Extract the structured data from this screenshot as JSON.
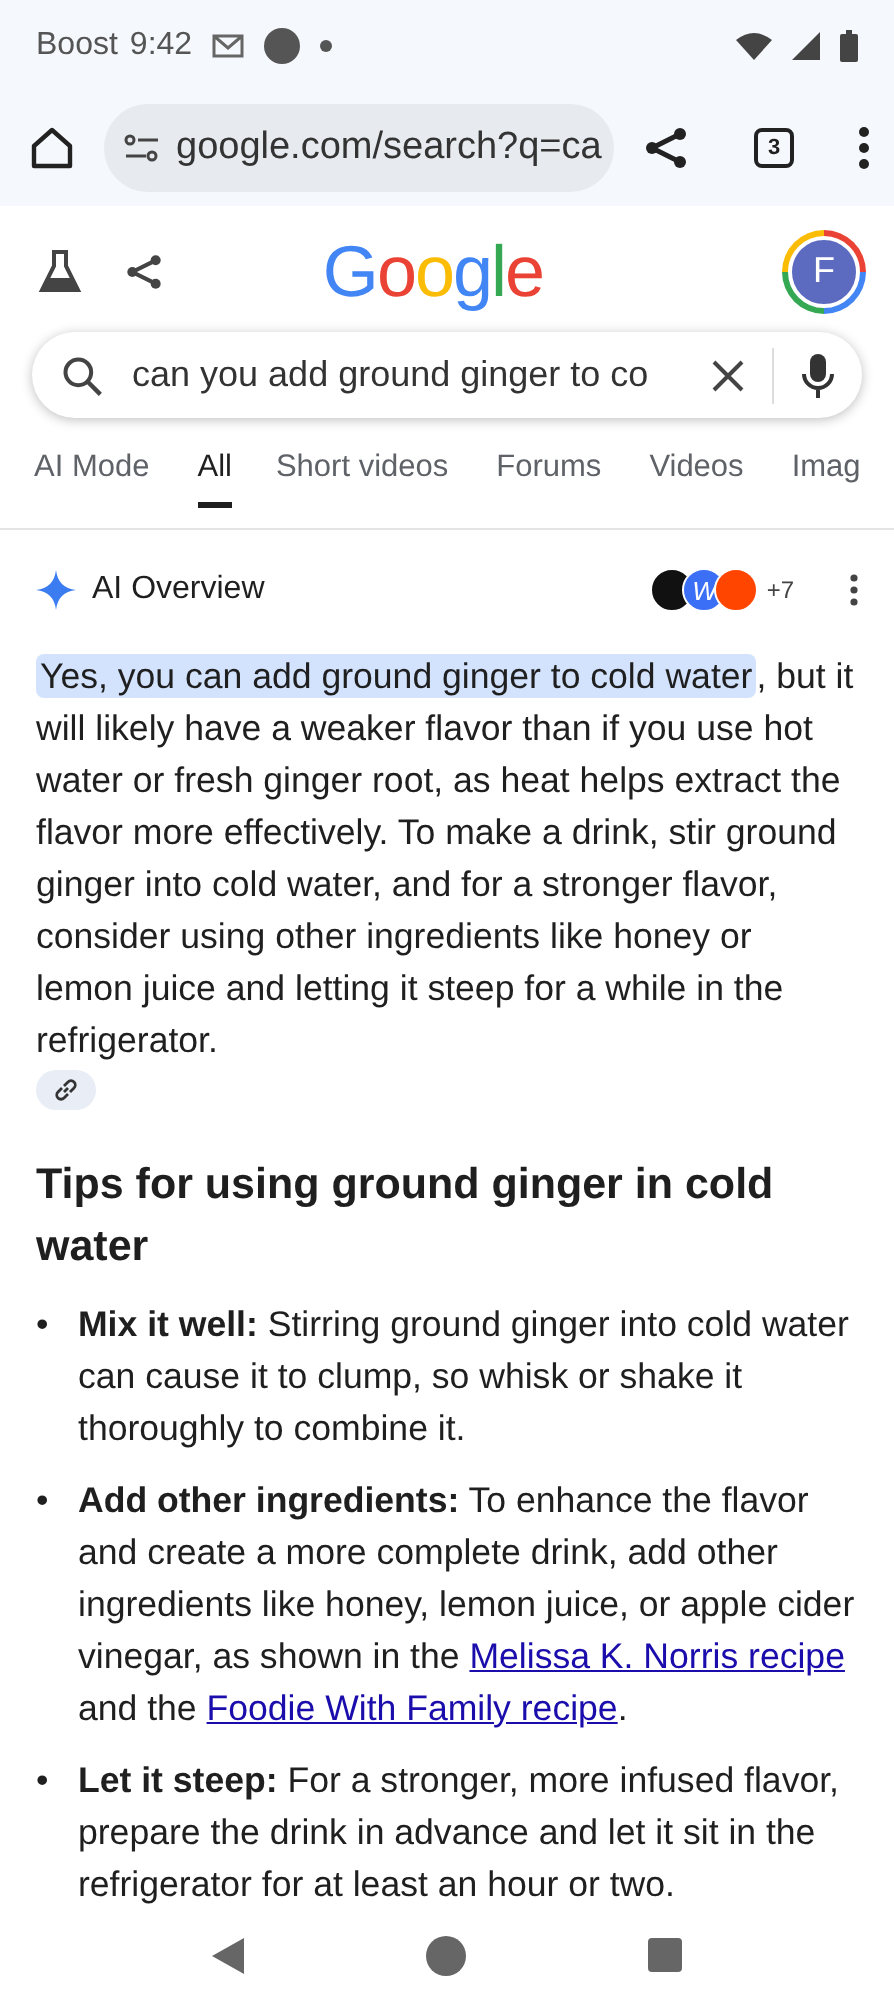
{
  "status_bar": {
    "carrier": "Boost",
    "time": "9:42"
  },
  "browser": {
    "url": "google.com/search?q=ca",
    "tab_count": "3"
  },
  "header": {
    "logo": "Google",
    "avatar": "F"
  },
  "search": {
    "value": "can you add ground ginger to co"
  },
  "tabs": [
    {
      "label": "AI Mode",
      "selected": false
    },
    {
      "label": "All",
      "selected": true
    },
    {
      "label": "Short videos",
      "selected": false
    },
    {
      "label": "Forums",
      "selected": false
    },
    {
      "label": "Videos",
      "selected": false
    },
    {
      "label": "Imag",
      "selected": false
    }
  ],
  "overview": {
    "title": "AI Overview",
    "source_letter": "W",
    "more_sources": "+7",
    "highlight": "Yes, you can add ground ginger to cold water",
    "text": ", but it will likely have a weaker flavor than if you use hot water or fresh ginger root, as heat helps extract the flavor more effectively. To make a drink, stir ground ginger into cold water, and for a stronger flavor, consider using other ingredients like honey or lemon juice and letting it steep for a while in the refrigerator."
  },
  "heading": "Tips for using ground ginger in cold water",
  "tips": [
    {
      "marker": "•",
      "title": "Mix it well:",
      "parts": [
        {
          "text": " Stirring ground ginger into cold water can cause it to clump, so whisk or shake it thoroughly to combine it.",
          "link": false
        }
      ]
    },
    {
      "marker": "•",
      "title": "Add other ingredients:",
      "parts": [
        {
          "text": " To enhance the flavor and create a more complete drink, add other ingredients like honey, lemon juice, or apple cider vinegar, as shown in the ",
          "link": false
        },
        {
          "text": "Melissa K. Norris recipe",
          "link": true
        },
        {
          "text": " and the ",
          "link": false
        },
        {
          "text": "Foodie With Family recipe",
          "link": true
        },
        {
          "text": ".",
          "link": false
        }
      ]
    },
    {
      "marker": "•",
      "title": "Let it steep:",
      "parts": [
        {
          "text": " For a stronger, more infused flavor, prepare the drink in advance and let it sit in the refrigerator for at least an hour or two.",
          "link": false
        }
      ]
    }
  ]
}
